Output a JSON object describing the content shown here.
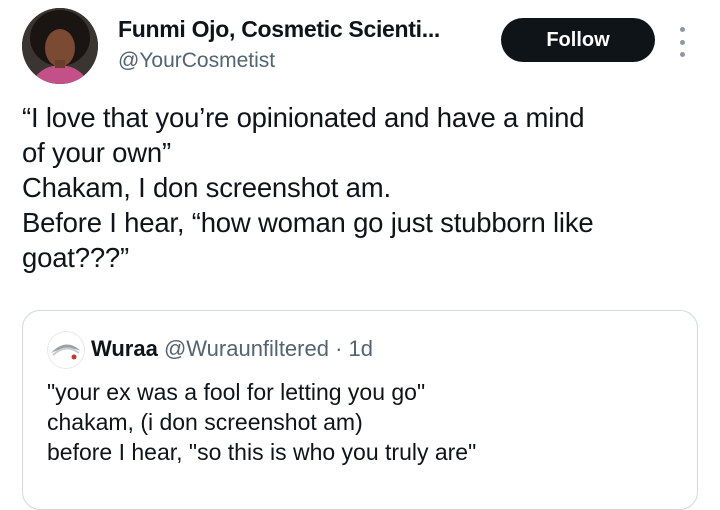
{
  "author": {
    "name": "Funmi Ojo, Cosmetic Scienti...",
    "handle": "@YourCosmetist",
    "avatar_icon": "profile-photo"
  },
  "actions": {
    "follow_label": "Follow",
    "more_icon": "more-vertical-icon"
  },
  "tweet": {
    "lines": [
      "“I love that you’re opinionated and have a mind",
      "of your own”",
      "Chakam, I don screenshot am.",
      "Before I hear, “how woman go just stubborn like",
      "goat???”"
    ]
  },
  "quoted": {
    "name": "Wuraa",
    "handle": "@Wuraunfiltered",
    "separator": "·",
    "time": "1d",
    "lines": [
      "\"your ex was a fool for letting you go\"",
      "chakam, (i don screenshot am)",
      "before I hear, \"so this is who you truly are\""
    ]
  },
  "colors": {
    "text": "#0f1419",
    "muted": "#536471",
    "follow_bg": "#0f1419",
    "border": "#cfd9de"
  }
}
